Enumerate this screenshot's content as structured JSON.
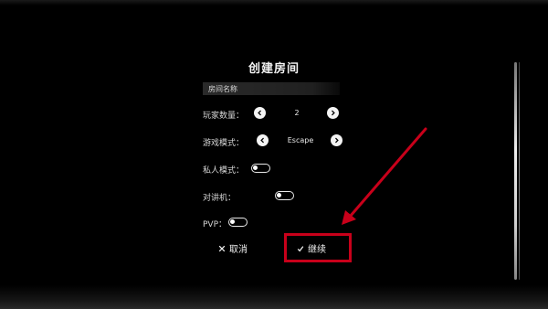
{
  "dialog": {
    "title": "创建房间",
    "room_name_placeholder": "房间名称"
  },
  "settings": {
    "players": {
      "label": "玩家数量：",
      "value": "2"
    },
    "mode": {
      "label": "游戏模式：",
      "value": "Escape"
    },
    "private": {
      "label": "私人模式：",
      "on": false
    },
    "voice": {
      "label": "对讲机：",
      "on": false
    },
    "pvp": {
      "label": "PVP：",
      "on": false
    }
  },
  "actions": {
    "cancel": "取消",
    "continue": "继续"
  },
  "icons": {
    "prev": "chevron-left-icon",
    "next": "chevron-right-icon",
    "cancel": "close-icon",
    "confirm": "check-icon"
  },
  "colors": {
    "background": "#000000",
    "highlight": "#c8001a",
    "text": "#e6e6e6"
  }
}
